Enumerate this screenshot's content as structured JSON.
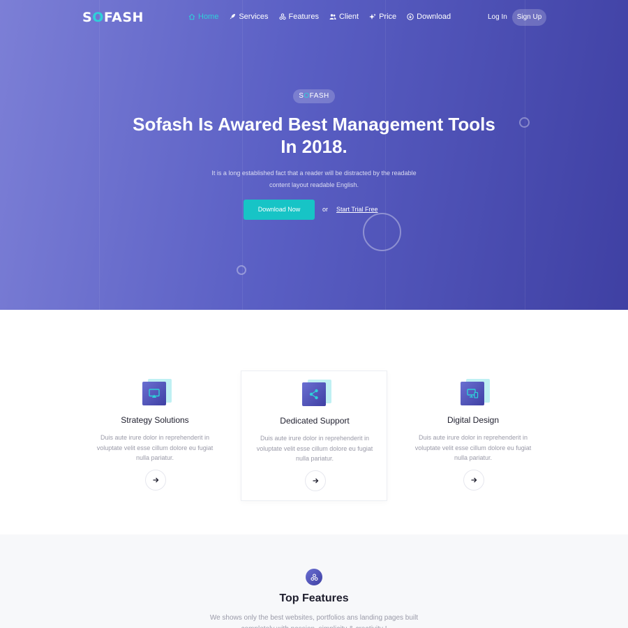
{
  "brand": {
    "logo_prefix": "S",
    "logo_accent": "O",
    "logo_suffix": "FASH",
    "accent_color": "#2fd0d9",
    "primary_color": "#4a4cb5"
  },
  "nav": {
    "items": [
      {
        "label": "Home",
        "icon": "home-icon",
        "active": true
      },
      {
        "label": "Services",
        "icon": "rocket-icon"
      },
      {
        "label": "Features",
        "icon": "cubes-icon"
      },
      {
        "label": "Client",
        "icon": "users-icon"
      },
      {
        "label": "Price",
        "icon": "sparkle-icon"
      },
      {
        "label": "Download",
        "icon": "download-circle-icon"
      }
    ],
    "login_label": "Log In",
    "signup_label": "Sign Up"
  },
  "hero": {
    "badge_prefix": "S",
    "badge_accent": "O",
    "badge_suffix": "FASH",
    "title_bold": "Sofash",
    "title_rest": " Is Awared Best Management Tools In 2018.",
    "description": "It is a long established fact that a reader will be distracted by the readable content layout readable English.",
    "download_label": "Download Now",
    "or_label": "or",
    "trial_label": "Start Trial Free"
  },
  "services": [
    {
      "title": "Strategy Solutions",
      "text": "Duis aute irure dolor in reprehenderit in voluptate velit esse cillum dolore eu fugiat nulla pariatur.",
      "icon": "airplay-icon"
    },
    {
      "title": "Dedicated Support",
      "text": "Duis aute irure dolor in reprehenderit in voluptate velit esse cillum dolore eu fugiat nulla pariatur.",
      "icon": "share-icon"
    },
    {
      "title": "Digital Design",
      "text": "Duis aute irure dolor in reprehenderit in voluptate velit esse cillum dolore eu fugiat nulla pariatur.",
      "icon": "devices-icon"
    }
  ],
  "features": {
    "icon": "cubes-icon",
    "title": "Top Features",
    "description": "We shows only the best websites, portfolios ans landing pages built completely with passion, simplicity & creativity !"
  }
}
